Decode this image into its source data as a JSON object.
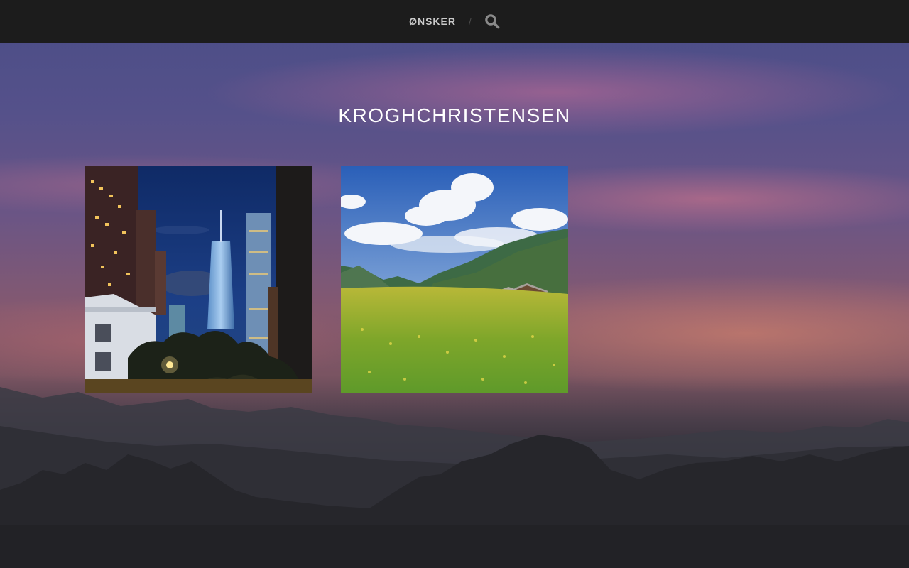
{
  "nav": {
    "menu_item": "ØNSKER",
    "separator": "/"
  },
  "site": {
    "title": "KROGHCHRISTENSEN"
  },
  "posts": [
    {
      "image": "city-skyline-night-photo"
    },
    {
      "image": "mountain-meadow-photo"
    }
  ],
  "colors": {
    "navbar": "#1c1c1c",
    "nav_text": "#c9c9c9",
    "title_text": "#ffffff"
  }
}
